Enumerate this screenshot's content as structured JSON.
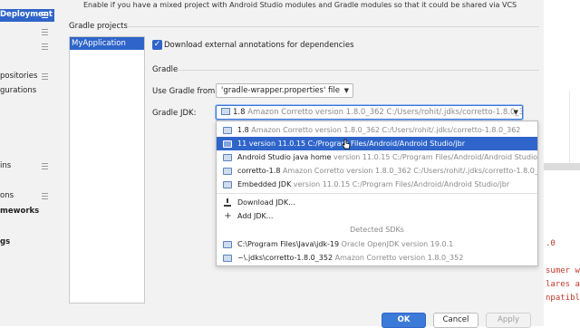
{
  "tree": {
    "items": [
      {
        "label": "Deployment",
        "selected": true,
        "bold": true
      },
      {
        "label": "",
        "selected": false
      },
      {
        "label": "",
        "selected": false
      },
      {
        "label": "positories",
        "selected": false
      },
      {
        "label": "gurations",
        "selected": false
      },
      {
        "label": "ins",
        "selected": false
      },
      {
        "label": "ons",
        "selected": false
      },
      {
        "label": "meworks",
        "selected": false,
        "bold": true
      },
      {
        "label": "gs",
        "selected": false,
        "bold": true
      }
    ]
  },
  "hint_text": "Enable if you have a mixed project with Android Studio modules and Gradle modules so that it could be shared via VCS",
  "gradle_projects": {
    "section_title": "Gradle projects",
    "projects": [
      "MyApplication"
    ]
  },
  "download_annotations": {
    "label": "Download external annotations for dependencies",
    "checked": true
  },
  "gradle_section": {
    "title": "Gradle",
    "use_gradle_from_label": "Use Gradle from:",
    "use_gradle_from_value": "'gradle-wrapper.properties' file",
    "gradle_jdk_label": "Gradle JDK:",
    "gradle_jdk_value_version": "1.8",
    "gradle_jdk_value_detail": "Amazon Corretto version 1.8.0_362 C:/Users/rohit/.jdks/corretto-1.8.0_362"
  },
  "jdk_popup": {
    "items": [
      {
        "name": "1.8",
        "detail": "Amazon Corretto version 1.8.0_362 C:/Users/rohit/.jdks/corretto-1.8.0_362",
        "highlighted": false
      },
      {
        "name": "11 version 11.0.15 C:/Program Files/Android/Android Studio/jbr",
        "detail": "",
        "highlighted": true
      },
      {
        "name": "Android Studio java home",
        "detail": "version 11.0.15 C:/Program Files/Android/Android Studio/jbr",
        "highlighted": false
      },
      {
        "name": "corretto-1.8",
        "detail": "Amazon Corretto version 1.8.0_362 C:/Users/rohit/.jdks/corretto-1.8.0_362",
        "highlighted": false
      },
      {
        "name": "Embedded JDK",
        "detail": "version 11.0.15 C:/Program Files/Android/Android Studio/jbr",
        "highlighted": false
      }
    ],
    "actions": [
      "Download JDK...",
      "Add JDK..."
    ],
    "detected_header": "Detected SDKs",
    "detected": [
      {
        "name": "C:\\Program Files\\Java\\jdk-19",
        "detail": "Oracle OpenJDK version 19.0.1"
      },
      {
        "name": "~\\.jdks\\corretto-1.8.0_352",
        "detail": "Amazon Corretto version 1.8.0_352"
      }
    ]
  },
  "buttons": {
    "ok": "OK",
    "cancel": "Cancel",
    "apply": "Apply"
  },
  "editor_snippets": [
    ".0",
    "sumer wa",
    "lares a ",
    "npatible"
  ],
  "colors": {
    "accent": "#2f65ca",
    "panel_bg": "#f2f2f2",
    "code_red": "#c0392b"
  }
}
